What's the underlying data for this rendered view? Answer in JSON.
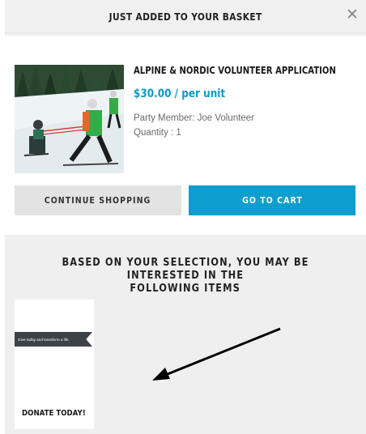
{
  "header": {
    "title": "JUST ADDED TO YOUR BASKET",
    "close_glyph": "✕"
  },
  "product": {
    "name": "ALPINE & NORDIC VOLUNTEER APPLICATION",
    "price": "$30.00 / per unit",
    "party_member": "Party Member: Joe Volunteer",
    "quantity": "Quantity : 1",
    "image_icon": "ski-volunteer-photo"
  },
  "buttons": {
    "continue": "CONTINUE SHOPPING",
    "cart": "GO TO CART"
  },
  "recommendations": {
    "heading_line1": "BASED ON YOUR SELECTION, YOU MAY BE INTERESTED IN THE",
    "heading_line2": "FOLLOWING ITEMS",
    "items": [
      {
        "banner_text": "Give today and transform a life.",
        "label": "DONATE TODAY!"
      }
    ]
  },
  "colors": {
    "accent": "#0b9ecf",
    "price": "#0d9ac8",
    "panel": "#efefef"
  }
}
